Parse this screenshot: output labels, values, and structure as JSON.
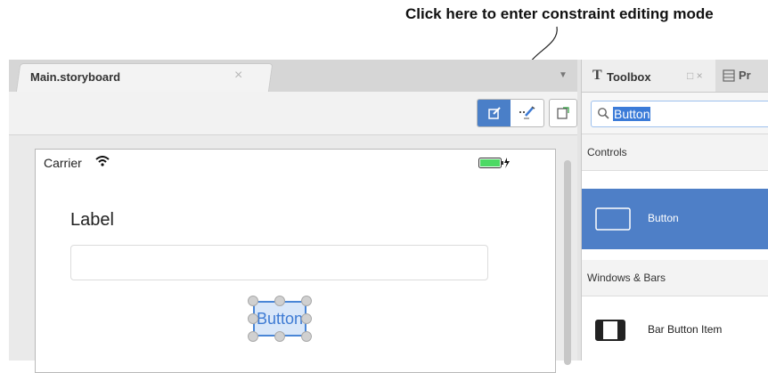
{
  "callout": {
    "text": "Click here to enter constraint editing mode"
  },
  "editor": {
    "tab_label": "Main.storyboard",
    "tab_close": "×",
    "tab_dropdown": "▼"
  },
  "phone": {
    "carrier": "Carrier",
    "label_text": "Label",
    "button_text": "Button"
  },
  "toolbox": {
    "title": "Toolbox",
    "title_icon": "T",
    "window_icons": "□ ×",
    "second_tab": "Pr",
    "search_value": "Button",
    "sections": [
      {
        "label": "Controls"
      },
      {
        "label": "Windows & Bars"
      }
    ],
    "items": [
      {
        "label": "Button",
        "selected": true
      },
      {
        "label": "Bar Button Item",
        "selected": false
      }
    ]
  },
  "colors": {
    "accent": "#4a7fc8",
    "selection": "#4e7fc7",
    "battery": "#4cd964"
  },
  "icons": [
    "edit-mode-icon",
    "constraint-mode-icon",
    "document-icon",
    "wifi-icon",
    "battery-icon",
    "search-icon",
    "button-item-icon",
    "bar-button-item-icon"
  ]
}
